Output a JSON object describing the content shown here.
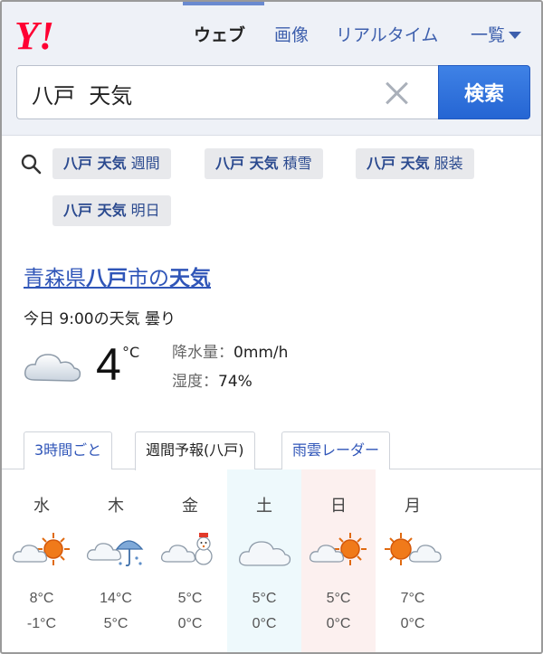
{
  "header": {
    "logo_text": "Y!",
    "nav": {
      "web": "ウェブ",
      "image": "画像",
      "realtime": "リアルタイム",
      "list": "一覧"
    },
    "search": {
      "value": "八戸  天気",
      "button": "検索"
    }
  },
  "related": [
    {
      "bold": "八戸 天気",
      "rest": " 週間"
    },
    {
      "bold": "八戸 天気",
      "rest": " 積雪"
    },
    {
      "bold": "八戸 天気",
      "rest": " 服装"
    },
    {
      "bold": "八戸 天気",
      "rest": " 明日"
    }
  ],
  "weather": {
    "title": {
      "pre": "青森県",
      "b1": "八戸",
      "mid": "市の",
      "b2": "天気"
    },
    "current_text": "今日 9:00の天気 曇り",
    "temp": "4",
    "unit": "°C",
    "precip_label": "降水量：",
    "precip_value": "0mm/h",
    "humidity_label": "湿度：",
    "humidity_value": "74%"
  },
  "tabs": [
    {
      "label": "3時間ごと"
    },
    {
      "label": "週間予報(八戸)"
    },
    {
      "label": "雨雲レーダー"
    }
  ],
  "forecast": [
    {
      "day": "水",
      "icon": "cloud-sun-icon",
      "high": "8°C",
      "low": "-1°C"
    },
    {
      "day": "木",
      "icon": "cloud-umbrella-icon",
      "high": "14°C",
      "low": "5°C"
    },
    {
      "day": "金",
      "icon": "cloud-snowman-icon",
      "high": "5°C",
      "low": "0°C"
    },
    {
      "day": "土",
      "icon": "cloud-icon",
      "high": "5°C",
      "low": "0°C"
    },
    {
      "day": "日",
      "icon": "cloud-sun-icon",
      "high": "5°C",
      "low": "0°C"
    },
    {
      "day": "月",
      "icon": "sun-cloud-icon",
      "high": "7°C",
      "low": "0°C"
    }
  ],
  "colors": {
    "logo": "#ff0033",
    "link": "#2f55b8",
    "button": "#2565d3",
    "sat_bg": "#eef9fc",
    "sun_bg": "#fcf0ef"
  }
}
